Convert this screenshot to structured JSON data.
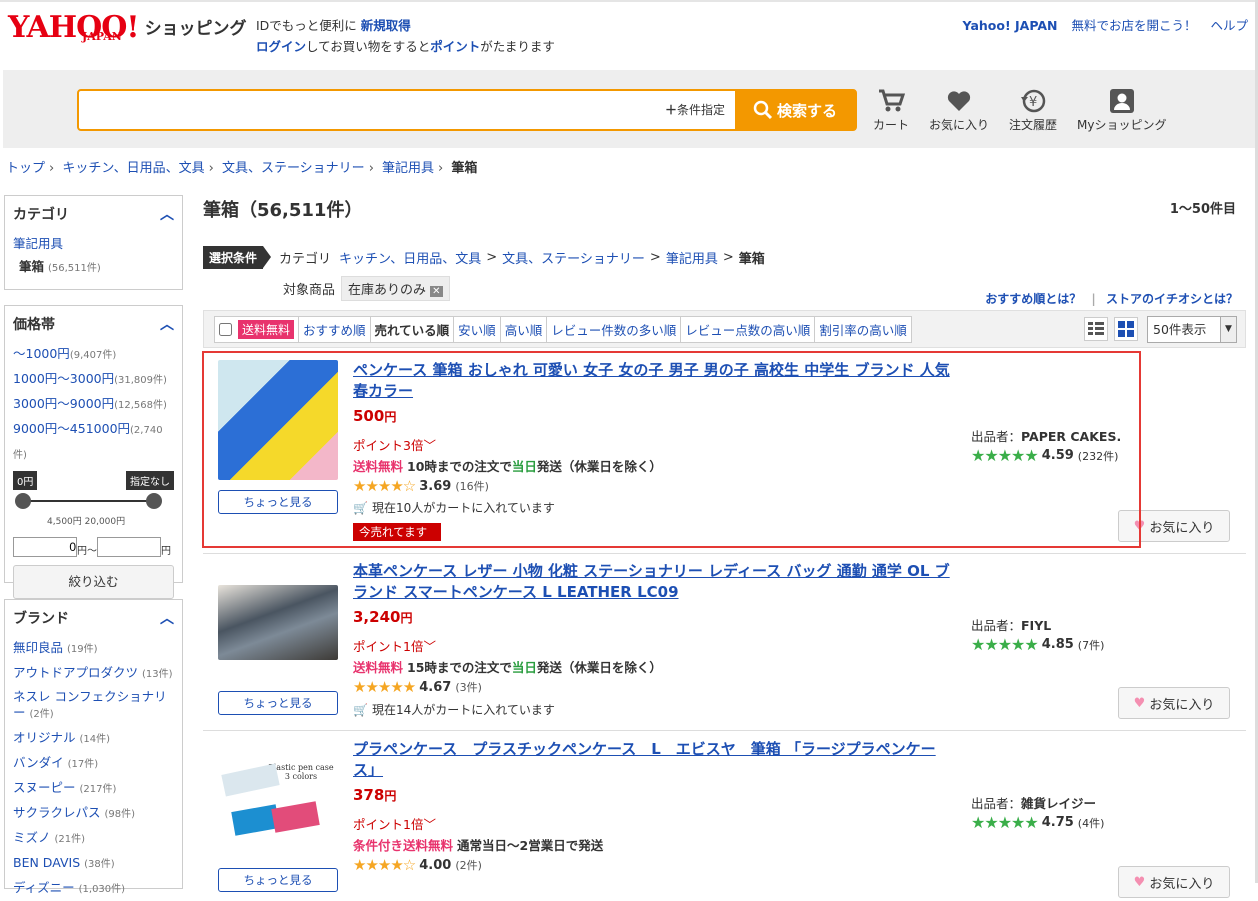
{
  "header": {
    "logo_yahoo": "YAHOO!",
    "logo_japan": "JAPAN",
    "logo_shop": "ショッピング",
    "line1_pre": "IDでもっと便利に",
    "line1_link": "新規取得",
    "line2_link": "ログイン",
    "line2_mid": "してお買い物をすると",
    "line2_link2": "ポイント",
    "line2_post": "がたまります",
    "right_links": [
      "Yahoo! JAPAN",
      "無料でお店を開こう！",
      "ヘルプ"
    ]
  },
  "search": {
    "placeholder": "",
    "condition_label": "条件指定",
    "button_label": "検索する"
  },
  "nav": [
    {
      "label": "カート",
      "icon": "cart-icon"
    },
    {
      "label": "お気に入り",
      "icon": "heart-icon"
    },
    {
      "label": "注文履歴",
      "icon": "history-icon"
    },
    {
      "label": "Myショッピング",
      "icon": "user-icon"
    }
  ],
  "breadcrumb": [
    "トップ",
    "キッチン、日用品、文具",
    "文具、ステーショナリー",
    "筆記用具",
    "筆箱"
  ],
  "sidebar": {
    "category": {
      "title": "カテゴリ",
      "parent": "筆記用具",
      "current": "筆箱",
      "current_count": "(56,511件)"
    },
    "price": {
      "title": "価格帯",
      "items": [
        {
          "label": "〜1000円",
          "count": "(9,407件)"
        },
        {
          "label": "1000円〜3000円",
          "count": "(31,809件)"
        },
        {
          "label": "3000円〜9000円",
          "count": "(12,568件)"
        },
        {
          "label": "9000円〜451000円",
          "count": "(2,740件)"
        }
      ],
      "slider_min_label": "0円",
      "slider_max_label": "指定なし",
      "tick_labels": "4,500円 20,000円",
      "min_value": "0",
      "min_unit": "円〜",
      "max_value": "",
      "max_unit": "円",
      "slider_min_fraction": 0,
      "slider_max_fraction": 1,
      "filter_button": "絞り込む"
    },
    "brand": {
      "title": "ブランド",
      "items": [
        {
          "label": "無印良品",
          "count": "(19件)"
        },
        {
          "label": "アウトドアプロダクツ",
          "count": "(13件)"
        },
        {
          "label": "ネスレ コンフェクショナリー",
          "count": "(2件)"
        },
        {
          "label": "オリジナル",
          "count": "(14件)"
        },
        {
          "label": "バンダイ",
          "count": "(17件)"
        },
        {
          "label": "スヌーピー",
          "count": "(217件)"
        },
        {
          "label": "サクラクレパス",
          "count": "(98件)"
        },
        {
          "label": "ミズノ",
          "count": "(21件)"
        },
        {
          "label": "BEN DAVIS",
          "count": "(38件)"
        },
        {
          "label": "ディズニー",
          "count": "(1,030件)"
        }
      ]
    }
  },
  "main": {
    "title": "筆箱（56,511件）",
    "range": "1〜50件目",
    "selected_label": "選択条件",
    "cond_category_label": "カテゴリ",
    "cond_path": [
      "キッチン、日用品、文具",
      "文具、ステーショナリー",
      "筆記用具",
      "筆箱"
    ],
    "target_label": "対象商品",
    "target_chip": "在庫ありのみ",
    "help_links": [
      "おすすめ順とは？",
      "ストアのイチオシとは？"
    ],
    "free_ship_label": "送料無料",
    "sort_tabs": [
      "おすすめ順",
      "売れている順",
      "安い順",
      "高い順",
      "レビュー件数の多い順",
      "レビュー点数の高い順",
      "割引率の高い順"
    ],
    "active_sort": "売れている順",
    "per_page": "50件表示"
  },
  "products": [
    {
      "name": "ペンケース 筆箱 おしゃれ 可愛い 女子 女の子 男子 男の子 高校生 中学生 ブランド 人気 春カラー",
      "price": "500",
      "unit": "円",
      "points": "ポイント3倍",
      "ship_label": "送料無料",
      "ship_time": "10時までの注文で",
      "ship_day": "当日",
      "ship_post": "発送（休業日を除く）",
      "rating": "3.69",
      "rating_stars": 3.69,
      "reviews": "(16件)",
      "cart_text": "現在10人がカートに入れています",
      "hot": "今売れてます",
      "seller_label": "出品者：",
      "seller": "PAPER CAKES.",
      "seller_rating": "4.59",
      "seller_stars": 4.59,
      "seller_reviews": "(232件)",
      "peek": "ちょっと見る",
      "fav": "お気に入り"
    },
    {
      "name": "本革ペンケース レザー 小物 化粧 ステーショナリー レディース バッグ 通勤 通学 OL ブランド スマートペンケース L LEATHER LC09",
      "price": "3,240",
      "unit": "円",
      "points": "ポイント1倍",
      "ship_label": "送料無料",
      "ship_time": "15時までの注文で",
      "ship_day": "当日",
      "ship_post": "発送（休業日を除く）",
      "rating": "4.67",
      "rating_stars": 4.67,
      "reviews": "(3件)",
      "cart_text": "現在14人がカートに入れています",
      "seller_label": "出品者：",
      "seller": "FIYL",
      "seller_rating": "4.85",
      "seller_stars": 4.85,
      "seller_reviews": "(7件)",
      "peek": "ちょっと見る",
      "fav": "お気に入り"
    },
    {
      "name": "プラペンケース　プラスチックペンケース　L　エビスヤ　筆箱 「ラージプラペンケース」",
      "price": "378",
      "unit": "円",
      "points": "ポイント1倍",
      "ship_label": "条件付き送料無料",
      "ship_time": "通常当日〜2営業日で発送",
      "rating": "4.00",
      "rating_stars": 4.0,
      "reviews": "(2件)",
      "seller_label": "出品者：",
      "seller": "雑貨レイジー",
      "seller_rating": "4.75",
      "seller_stars": 4.75,
      "seller_reviews": "(4件)",
      "peek": "ちょっと見る",
      "fav": "お気に入り",
      "image_caption": "Plastic pen case 3 colors"
    }
  ]
}
